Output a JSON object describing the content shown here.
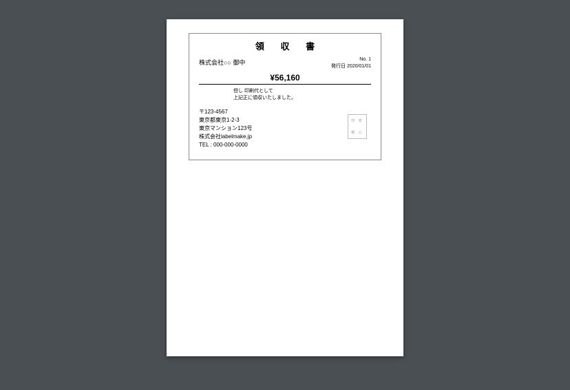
{
  "title": "領 収 書",
  "recipient": "株式会社○○ 御中",
  "meta": {
    "no_label": "No.",
    "no_value": "1",
    "date_label": "発行日",
    "date_value": "2020/01/01"
  },
  "amount": "¥56,160",
  "note": {
    "line1": "但し 印刷代として",
    "line2": "上記正に領収いたしました。"
  },
  "sender": {
    "postal": "〒123-4567",
    "addr1": "東京都東京1-2-3",
    "addr2": "東京マンション123号",
    "company": "株式会社labelmake.jp",
    "tel": "TEL : 000-000-0000"
  },
  "stamp": {
    "line1": "印 収",
    "line2": "紙 入"
  }
}
